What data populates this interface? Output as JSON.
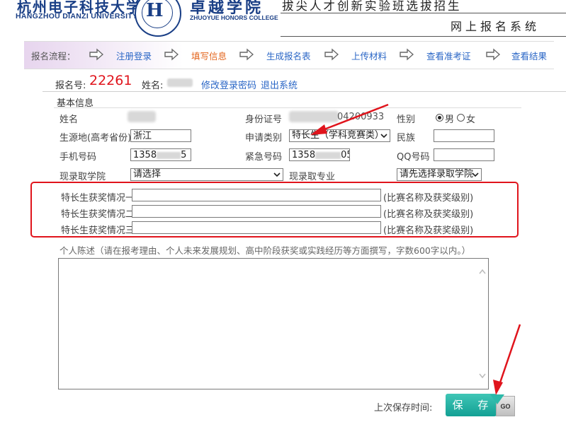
{
  "header": {
    "university_name": "杭州电子科技大学",
    "university_name_en": "HANGZHOU DIANZI UNIVERSITY",
    "college_name": "卓越学院",
    "college_name_en": "ZHUOYUE HONORS COLLEGE",
    "slogan": "拔尖人才创新实验班选拔招生",
    "system_title": "网上报名系统"
  },
  "flow": {
    "label": "报名流程：",
    "steps": [
      {
        "label": "注册登录",
        "current": false
      },
      {
        "label": "填写信息",
        "current": true
      },
      {
        "label": "生成报名表",
        "current": false
      },
      {
        "label": "上传材料",
        "current": false
      },
      {
        "label": "查看准考证",
        "current": false
      },
      {
        "label": "查看结果",
        "current": false
      }
    ]
  },
  "reg": {
    "reg_label": "报名号:",
    "reg_no": "22261",
    "name_label": "姓名:",
    "change_password": "修改登录密码",
    "logout": "退出系统"
  },
  "basic": {
    "section_title": "基本信息",
    "name_label": "姓名",
    "id_label": "身份证号",
    "id_value_suffix": "04200933",
    "gender_label": "性别",
    "gender_male": "男",
    "gender_female": "女",
    "gender_selected": "男",
    "origin_label": "生源地(高考省份)",
    "origin_value": "浙江",
    "apply_type_label": "申请类别",
    "apply_type_value": "特长生（学科竞赛类）",
    "ethnicity_label": "民族",
    "ethnicity_value": "",
    "phone_label": "手机号码",
    "phone_prefix": "1358",
    "phone_suffix": "5",
    "emergency_label": "紧急号码",
    "emergency_prefix": "1358",
    "emergency_suffix": "05",
    "qq_label": "QQ号码",
    "qq_value": "",
    "college_label": "现录取学院",
    "college_value": "请选择",
    "major_label": "现录取专业",
    "major_value": "请先选择录取学院"
  },
  "awards": {
    "rows": [
      {
        "label": "特长生获奖情况一",
        "value": "",
        "hint": "(比赛名称及获奖级别)"
      },
      {
        "label": "特长生获奖情况二",
        "value": "",
        "hint": "(比赛名称及获奖级别)"
      },
      {
        "label": "特长生获奖情况三",
        "value": "",
        "hint": "(比赛名称及获奖级别)"
      }
    ]
  },
  "statement": {
    "label": "个人陈述（请在报考理由、个人未来发展规划、高中阶段获奖或实践经历等方面撰写，字数600字以内。）",
    "value": ""
  },
  "footer": {
    "last_saved_label": "上次保存时间:",
    "save_label": "保 存",
    "go_label": "GO"
  },
  "colors": {
    "brand_blue": "#1a3f86",
    "link_blue": "#2a66c6",
    "current_orange": "#e3661e",
    "reg_red": "#e0141c",
    "save_green": "#13a094"
  }
}
